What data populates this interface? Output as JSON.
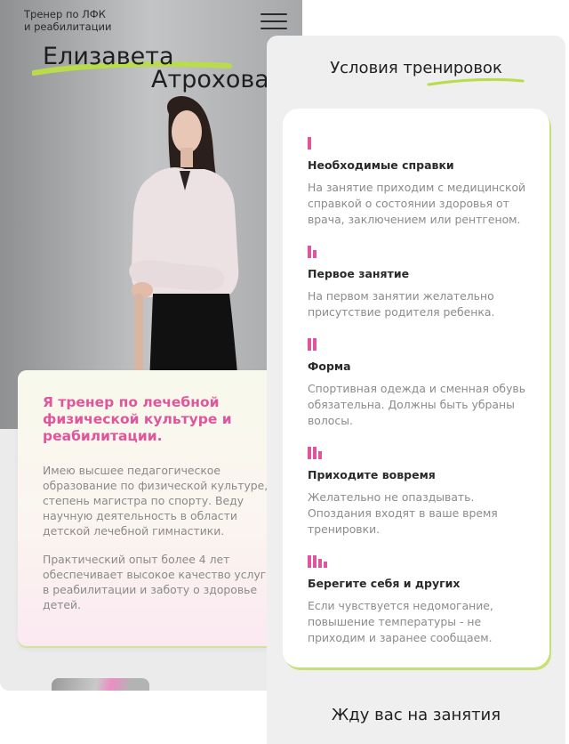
{
  "header": {
    "brand_lines": "Тренер по ЛФК\nи реабилитации",
    "menu_icon": "hamburger-menu-icon"
  },
  "hero": {
    "first_name": "Елизавета",
    "last_name": "Атрохова",
    "accent_color": "#b8dc4a"
  },
  "about": {
    "title": "Я тренер по лечебной физической культуре и реабилитации.",
    "paragraph_1": "Имею высшее педагогическое образование по физической культуре, степень магистра по спорту. Веду научную деятельность в области детской лечебной гимнастики.",
    "paragraph_2": "Практический опыт более 4 лет обеспечивает высокое качество услуг в реабилитации и заботу о здоровье детей.",
    "title_color": "#e0559b"
  },
  "conditions": {
    "title": "Условия тренировок",
    "items": [
      {
        "icon": "bar-level-1-icon",
        "title": "Необходимые справки",
        "text": "На занятие приходим с медицинской справкой о состоянии здоровья от врача, заключением или рентгеном."
      },
      {
        "icon": "bar-level-2-icon",
        "title": "Первое занятие",
        "text": "На первом занятии желательно присутствие родителя ребенка."
      },
      {
        "icon": "bar-level-3-icon",
        "title": "Форма",
        "text": "Спортивная одежда и сменная обувь обязательна. Должны быть убраны волосы."
      },
      {
        "icon": "bar-level-4-icon",
        "title": "Приходите вовремя",
        "text": "Желательно не опаздывать. Опоздания входят в ваше время тренировки."
      },
      {
        "icon": "bar-level-5-icon",
        "title": "Берегите себя и других",
        "text": "Если чувствуется недомогание, повышение температуры - не приходим и заранее сообщаем."
      }
    ],
    "icon_color": "#e0559b",
    "card_shadow_color": "#c5e077"
  },
  "footer": {
    "title": "Жду вас на занятия"
  }
}
